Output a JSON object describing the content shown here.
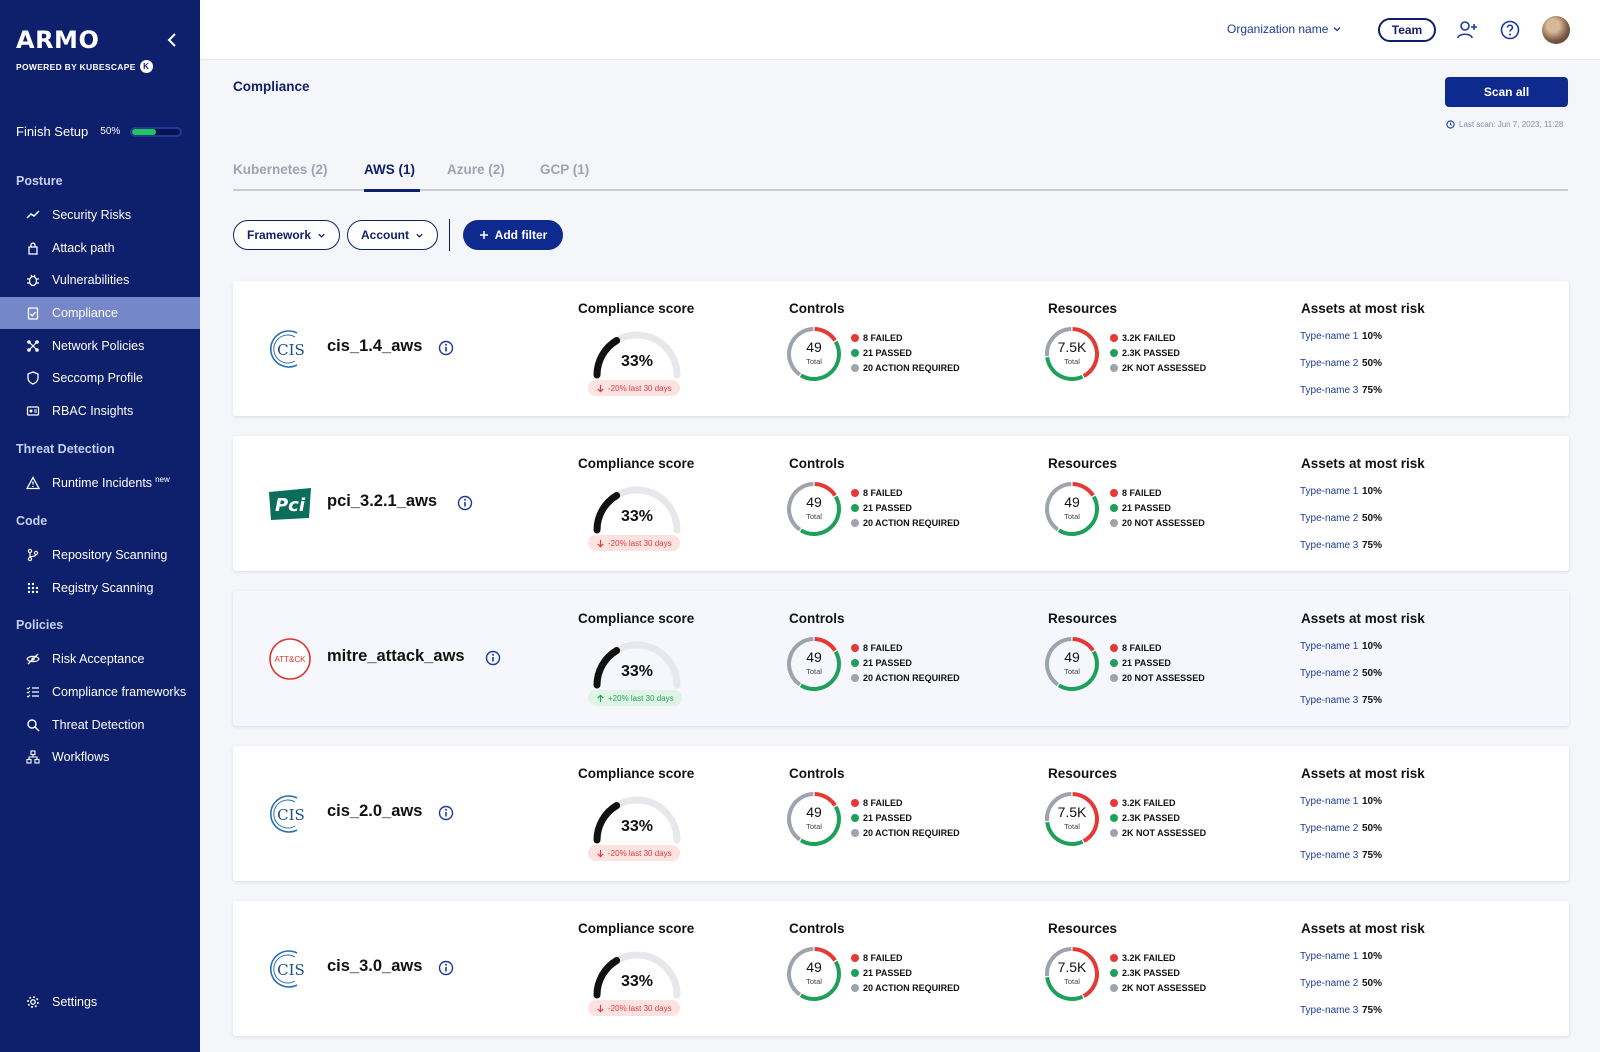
{
  "brand": {
    "name": "ARMO",
    "powered_by": "POWERED BY KUBESCAPE",
    "k_glyph": "K"
  },
  "finish_setup": {
    "label": "Finish Setup",
    "percent_text": "50%",
    "progress": 0.5
  },
  "sidebar": {
    "sections": {
      "posture": "Posture",
      "threat_detection": "Threat Detection",
      "code": "Code",
      "policies": "Policies"
    },
    "items": {
      "security_risks": "Security Risks",
      "attack_path": "Attack path",
      "vulnerabilities": "Vulnerabilities",
      "compliance": "Compliance",
      "network_policies": "Network Policies",
      "seccomp_profile": "Seccomp Profile",
      "rbac_insights": "RBAC Insights",
      "runtime_incidents": "Runtime Incidents",
      "runtime_badge": "new",
      "repository_scanning": "Repository Scanning",
      "registry_scanning": "Registry Scanning",
      "risk_acceptance": "Risk Acceptance",
      "compliance_frameworks": "Compliance frameworks",
      "threat_detection": "Threat Detection",
      "workflows": "Workflows",
      "settings": "Settings"
    }
  },
  "topbar": {
    "org_name": "Organization name",
    "team": "Team"
  },
  "page": {
    "title": "Compliance",
    "scan_all": "Scan all",
    "last_scan": "Last scan: Jun 7, 2023, 11:28"
  },
  "tabs": [
    "Kubernetes (2)",
    "AWS (1)",
    "Azure (2)",
    "GCP (1)"
  ],
  "filters": {
    "framework": "Framework",
    "account": "Account",
    "add_filter": "Add filter"
  },
  "labels": {
    "compliance_score": "Compliance score",
    "controls": "Controls",
    "resources": "Resources",
    "assets_at_most_risk": "Assets at most risk",
    "total": "Total"
  },
  "colors": {
    "failed": "#e53935",
    "passed": "#1fa05a",
    "neutral": "#9ea3ad",
    "navy": "#0e1f6b"
  },
  "cards": [
    {
      "logo": "CIS",
      "name": "cis_1.4_aws",
      "score_text": "33%",
      "score": 0.33,
      "trend": "-20% last 30 days",
      "trend_dir": "down",
      "controls": {
        "total_text": "49",
        "failed": 8,
        "passed": 21,
        "other": 20,
        "l1": "8 FAILED",
        "l2": "21 PASSED",
        "l3": "20 ACTION REQUIRED"
      },
      "resources": {
        "total_text": "7.5K",
        "failed": 3200,
        "passed": 2300,
        "other": 2000,
        "l1": "3.2K FAILED",
        "l2": "2.3K PASSED",
        "l3": "2K NOT ASSESSED"
      },
      "assets": [
        {
          "type": "Type-name 1",
          "pct": "10%"
        },
        {
          "type": "Type-name 2",
          "pct": "50%"
        },
        {
          "type": "Type-name 3",
          "pct": "75%"
        }
      ]
    },
    {
      "logo": "PCI",
      "name": "pci_3.2.1_aws",
      "score_text": "33%",
      "score": 0.33,
      "trend": "-20% last 30 days",
      "trend_dir": "down",
      "controls": {
        "total_text": "49",
        "failed": 8,
        "passed": 21,
        "other": 20,
        "l1": "8 FAILED",
        "l2": "21 PASSED",
        "l3": "20 ACTION REQUIRED"
      },
      "resources": {
        "total_text": "49",
        "failed": 8,
        "passed": 21,
        "other": 20,
        "l1": "8 FAILED",
        "l2": "21 PASSED",
        "l3": "20 NOT ASSESSED"
      },
      "assets": [
        {
          "type": "Type-name 1",
          "pct": "10%"
        },
        {
          "type": "Type-name 2",
          "pct": "50%"
        },
        {
          "type": "Type-name 3",
          "pct": "75%"
        }
      ]
    },
    {
      "logo": "ATT&CK",
      "name": "mitre_attack_aws",
      "score_text": "33%",
      "score": 0.33,
      "trend": "+20% last 30 days",
      "trend_dir": "up",
      "controls": {
        "total_text": "49",
        "failed": 8,
        "passed": 21,
        "other": 20,
        "l1": "8 FAILED",
        "l2": "21 PASSED",
        "l3": "20 ACTION REQUIRED"
      },
      "resources": {
        "total_text": "49",
        "failed": 8,
        "passed": 21,
        "other": 20,
        "l1": "8 FAILED",
        "l2": "21 PASSED",
        "l3": "20 NOT ASSESSED"
      },
      "assets": [
        {
          "type": "Type-name 1",
          "pct": "10%"
        },
        {
          "type": "Type-name 2",
          "pct": "50%"
        },
        {
          "type": "Type-name 3",
          "pct": "75%"
        }
      ]
    },
    {
      "logo": "CIS",
      "name": "cis_2.0_aws",
      "score_text": "33%",
      "score": 0.33,
      "trend": "-20% last 30 days",
      "trend_dir": "down",
      "controls": {
        "total_text": "49",
        "failed": 8,
        "passed": 21,
        "other": 20,
        "l1": "8 FAILED",
        "l2": "21 PASSED",
        "l3": "20 ACTION REQUIRED"
      },
      "resources": {
        "total_text": "7.5K",
        "failed": 3200,
        "passed": 2300,
        "other": 2000,
        "l1": "3.2K FAILED",
        "l2": "2.3K PASSED",
        "l3": "2K NOT ASSESSED"
      },
      "assets": [
        {
          "type": "Type-name 1",
          "pct": "10%"
        },
        {
          "type": "Type-name 2",
          "pct": "50%"
        },
        {
          "type": "Type-name 3",
          "pct": "75%"
        }
      ]
    },
    {
      "logo": "CIS",
      "name": "cis_3.0_aws",
      "score_text": "33%",
      "score": 0.33,
      "trend": "-20% last 30 days",
      "trend_dir": "down",
      "controls": {
        "total_text": "49",
        "failed": 8,
        "passed": 21,
        "other": 20,
        "l1": "8 FAILED",
        "l2": "21 PASSED",
        "l3": "20 ACTION REQUIRED"
      },
      "resources": {
        "total_text": "7.5K",
        "failed": 3200,
        "passed": 2300,
        "other": 2000,
        "l1": "3.2K FAILED",
        "l2": "2.3K PASSED",
        "l3": "2K NOT ASSESSED"
      },
      "assets": [
        {
          "type": "Type-name 1",
          "pct": "10%"
        },
        {
          "type": "Type-name 2",
          "pct": "50%"
        },
        {
          "type": "Type-name 3",
          "pct": "75%"
        }
      ]
    }
  ]
}
